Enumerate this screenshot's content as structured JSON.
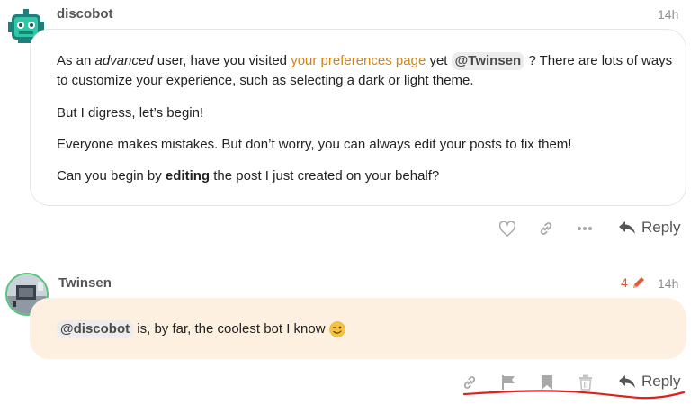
{
  "post1": {
    "username": "discobot",
    "time": "14h",
    "para1_a": "As an ",
    "para1_em": "advanced",
    "para1_b": " user, have you visited ",
    "para1_link": "your preferences page",
    "para1_c": " yet ",
    "para1_mention": "@Twinsen",
    "para1_d": " ? There are lots of ways to customize your experience, such as selecting a dark or light theme.",
    "para2": "But I digress, let’s begin!",
    "para3": "Everyone makes mistakes. But don’t worry, you can always edit your posts to fix them!",
    "para4_a": "Can you begin by ",
    "para4_b": "editing",
    "para4_c": " the post I just created on your behalf?",
    "actions": {
      "like_icon": "heart-icon",
      "link_icon": "link-icon",
      "more_icon": "more-dots-icon",
      "reply_label": "Reply"
    }
  },
  "post2": {
    "username": "Twinsen",
    "edit_count": "4",
    "time": "14h",
    "mention": "@discobot",
    "text": " is, by far, the coolest bot I know",
    "emoji": "😉",
    "actions": {
      "link_icon": "link-icon",
      "flag_icon": "flag-icon",
      "bookmark_icon": "bookmark-icon",
      "delete_icon": "trash-icon",
      "reply_label": "Reply"
    }
  },
  "colors": {
    "accent_link": "#d0831a",
    "edit_indicator": "#e45735",
    "highlight_bg": "#fdf0e1",
    "annotation": "#e0201c"
  }
}
